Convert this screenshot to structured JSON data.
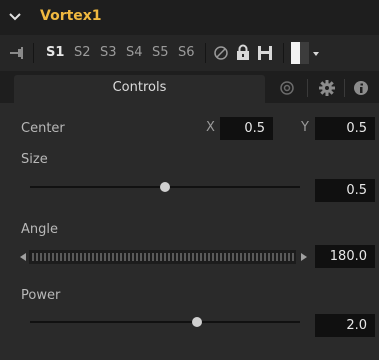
{
  "node": {
    "name": "Vortex1"
  },
  "toolbar": {
    "slots": [
      "S1",
      "S2",
      "S3",
      "S4",
      "S5",
      "S6"
    ],
    "active_slot": "S1"
  },
  "tabs": {
    "controls_label": "Controls"
  },
  "center": {
    "label": "Center",
    "x_axis": "X",
    "x_value": "0.5",
    "y_axis": "Y",
    "y_value": "0.5"
  },
  "size": {
    "label": "Size",
    "value": "0.5",
    "slider_position": 0.5
  },
  "angle": {
    "label": "Angle",
    "value": "180.0"
  },
  "power": {
    "label": "Power",
    "value": "2.0",
    "slider_position": 0.62
  },
  "colors": {
    "accent": "#f0b940",
    "panel": "#2a2a2a",
    "field": "#101010"
  }
}
